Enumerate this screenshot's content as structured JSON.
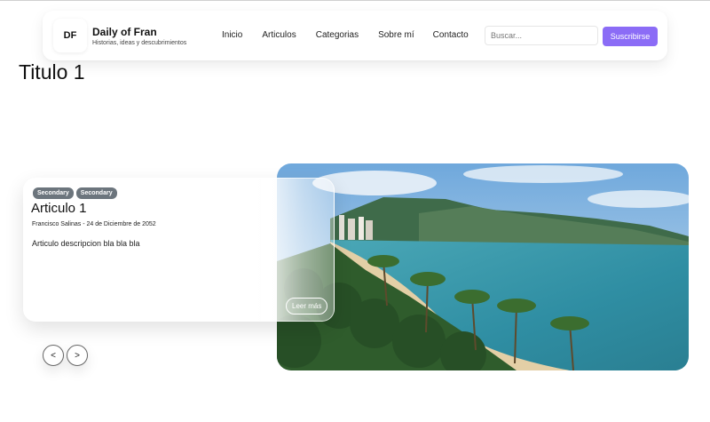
{
  "header": {
    "logo_text": "DF",
    "brand_title": "Daily of Fran",
    "brand_subtitle": "Historias, ideas y descubrimientos",
    "nav": [
      "Inicio",
      "Articulos",
      "Categorias",
      "Sobre mí",
      "Contacto"
    ],
    "search_placeholder": "Buscar...",
    "subscribe_label": "Suscribirse",
    "accent_color": "#8b6cf6"
  },
  "page": {
    "title": "Titulo 1"
  },
  "carousel": {
    "article": {
      "tags": [
        "Secondary",
        "Secondary"
      ],
      "title": "Articulo 1",
      "meta": "Francisco Salinas - 24 de Diciembre de 2052",
      "description": "Articulo descripcion bla bla bla",
      "read_more_label": "Leer más"
    },
    "prev_label": "<",
    "next_label": ">",
    "image_subject": "beach-bay-with-palm-trees"
  }
}
